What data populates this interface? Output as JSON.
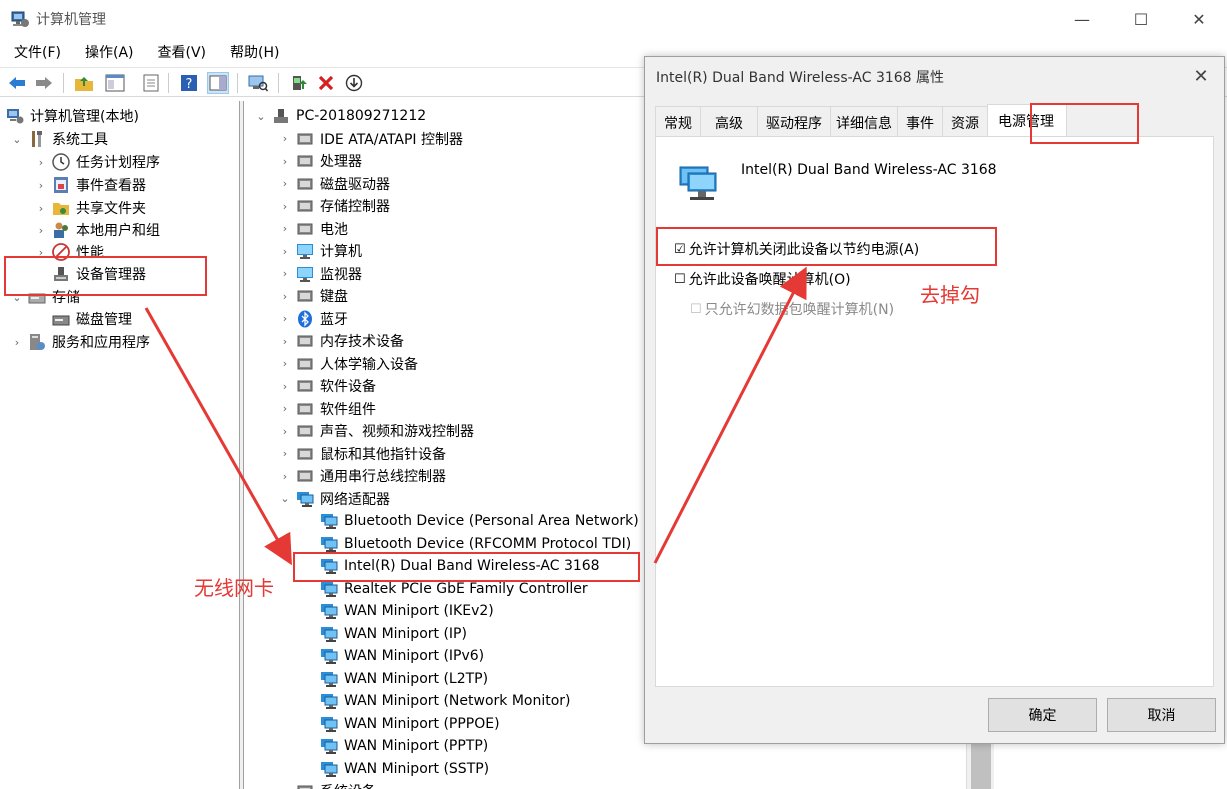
{
  "window": {
    "title": "计算机管理",
    "minimize": "—",
    "maximize": "☐",
    "close": "✕"
  },
  "menu": [
    "文件(F)",
    "操作(A)",
    "查看(V)",
    "帮助(H)"
  ],
  "left_tree": [
    {
      "label": "计算机管理(本地)",
      "icon": "computer-management-icon",
      "chevron": ""
    },
    {
      "label": "系统工具",
      "icon": "tools-icon",
      "chevron": "⌄"
    },
    {
      "label": "任务计划程序",
      "icon": "clock-icon",
      "chevron": "›"
    },
    {
      "label": "事件查看器",
      "icon": "event-viewer-icon",
      "chevron": "›"
    },
    {
      "label": "共享文件夹",
      "icon": "shared-folder-icon",
      "chevron": "›"
    },
    {
      "label": "本地用户和组",
      "icon": "users-icon",
      "chevron": "›"
    },
    {
      "label": "性能",
      "icon": "performance-icon",
      "chevron": "›"
    },
    {
      "label": "设备管理器",
      "icon": "device-manager-icon",
      "chevron": ""
    },
    {
      "label": "存储",
      "icon": "storage-icon",
      "chevron": "⌄"
    },
    {
      "label": "磁盘管理",
      "icon": "disk-icon",
      "chevron": ""
    },
    {
      "label": "服务和应用程序",
      "icon": "services-icon",
      "chevron": "›"
    }
  ],
  "device_tree": {
    "root": "PC-201809271212",
    "categories": [
      {
        "label": "IDE ATA/ATAPI 控制器",
        "icon": "ide-icon"
      },
      {
        "label": "处理器",
        "icon": "processor-icon"
      },
      {
        "label": "磁盘驱动器",
        "icon": "disk-drive-icon"
      },
      {
        "label": "存储控制器",
        "icon": "storage-controller-icon"
      },
      {
        "label": "电池",
        "icon": "battery-icon"
      },
      {
        "label": "计算机",
        "icon": "computer-icon"
      },
      {
        "label": "监视器",
        "icon": "monitor-icon"
      },
      {
        "label": "键盘",
        "icon": "keyboard-icon"
      },
      {
        "label": "蓝牙",
        "icon": "bluetooth-icon"
      },
      {
        "label": "内存技术设备",
        "icon": "memory-icon"
      },
      {
        "label": "人体学输入设备",
        "icon": "hid-icon"
      },
      {
        "label": "软件设备",
        "icon": "software-device-icon"
      },
      {
        "label": "软件组件",
        "icon": "software-component-icon"
      },
      {
        "label": "声音、视频和游戏控制器",
        "icon": "sound-icon"
      },
      {
        "label": "鼠标和其他指针设备",
        "icon": "mouse-icon"
      },
      {
        "label": "通用串行总线控制器",
        "icon": "usb-icon"
      }
    ],
    "network_adapters_label": "网络适配器",
    "network_adapters": [
      "Bluetooth Device (Personal Area Network)",
      "Bluetooth Device (RFCOMM Protocol TDI)",
      "Intel(R) Dual Band Wireless-AC 3168",
      "Realtek PCIe GbE Family Controller",
      "WAN Miniport (IKEv2)",
      "WAN Miniport (IP)",
      "WAN Miniport (IPv6)",
      "WAN Miniport (L2TP)",
      "WAN Miniport (Network Monitor)",
      "WAN Miniport (PPPOE)",
      "WAN Miniport (PPTP)",
      "WAN Miniport (SSTP)"
    ],
    "next_category": "系统设备"
  },
  "dialog": {
    "title": "Intel(R) Dual Band Wireless-AC 3168 属性",
    "close": "✕",
    "tabs": [
      "常规",
      "高级",
      "驱动程序",
      "详细信息",
      "事件",
      "资源",
      "电源管理"
    ],
    "active_tab": "电源管理",
    "device_name": "Intel(R) Dual Band Wireless-AC 3168",
    "options": [
      {
        "label": "允许计算机关闭此设备以节约电源(A)",
        "checked": true,
        "mark": "☑"
      },
      {
        "label": "允许此设备唤醒计算机(O)",
        "checked": false,
        "mark": "☐"
      },
      {
        "label": "只允许幻数据包唤醒计算机(N)",
        "checked": false,
        "mark": "☐",
        "disabled": true
      }
    ],
    "ok": "确定",
    "cancel": "取消"
  },
  "annotations": {
    "wireless_card": "无线网卡",
    "uncheck": "去掉勾",
    "color": "#e53935"
  }
}
